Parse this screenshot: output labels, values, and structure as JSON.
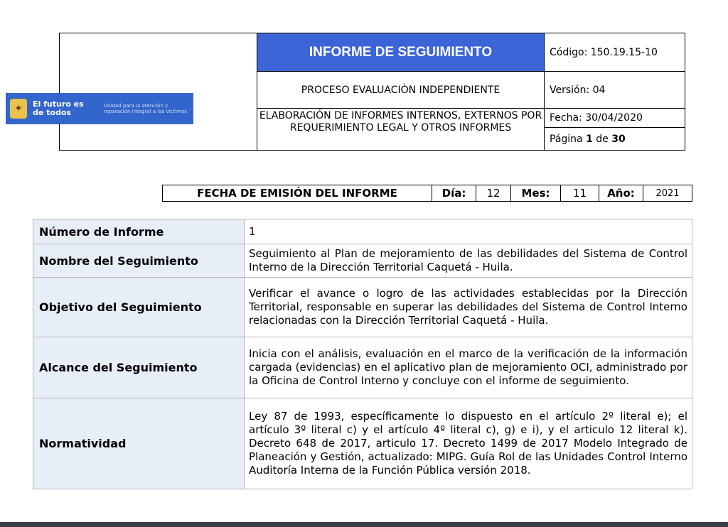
{
  "logo": {
    "tagline": "El futuro es de todos",
    "unit": "Unidad para la atención y reparación integral a las víctimas"
  },
  "header": {
    "title": "INFORME DE SEGUIMIENTO",
    "process": "PROCESO EVALUACIÒN INDEPENDIENTE",
    "elaboration": "ELABORACIÓN DE INFORMES INTERNOS, EXTERNOS POR REQUERIMIENTO LEGAL Y OTROS INFORMES",
    "code": "Código: 150.19.15-10",
    "version": "Versión: 04",
    "date": "Fecha: 30/04/2020",
    "page_label": "Página",
    "page_current": "1",
    "page_of": "de",
    "page_total": "30"
  },
  "emission": {
    "title": "FECHA DE EMISIÓN DEL INFORME",
    "day_label": "Día:",
    "day": "12",
    "month_label": "Mes:",
    "month": "11",
    "year_label": "Año:",
    "year": "2021"
  },
  "info": {
    "numero_label": "Número de Informe",
    "numero": "1",
    "nombre_label": "Nombre del Seguimiento",
    "nombre": "Seguimiento al Plan de mejoramiento de las debilidades del Sistema de Control Interno de la Dirección Territorial Caquetá - Huila.",
    "objetivo_label": "Objetivo del Seguimiento",
    "objetivo": "Verificar el avance o logro de las actividades establecidas por la Dirección Territorial, responsable en superar las debilidades del Sistema de Control Interno relacionadas con la Dirección Territorial Caquetá - Huila.",
    "alcance_label": "Alcance del Seguimiento",
    "alcance": "Inicia con el análisis, evaluación en el marco de la verificación de la información cargada (evidencias) en el aplicativo plan de mejoramiento OCI, administrado por la Oficina de Control Interno y concluye con el informe de seguimiento.",
    "normatividad_label": "Normatividad",
    "normatividad": "Ley 87 de 1993, específicamente lo dispuesto en el artículo 2º literal e); el artículo 3º literal c) y el artículo 4º literal c), g) e i), y el articulo 12 literal k). Decreto 648 de 2017, articulo 17. Decreto 1499 de 2017 Modelo Integrado de Planeación y Gestión, actualizado: MIPG. Guía Rol de las Unidades Control Interno Auditoría Interna de la Función Pública versión 2018."
  }
}
